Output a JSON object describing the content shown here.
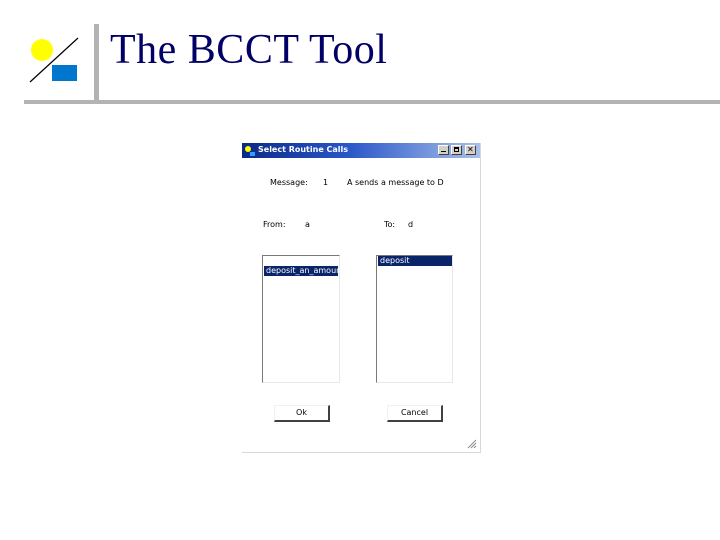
{
  "slide": {
    "title": "The BCCT Tool"
  },
  "dialog": {
    "title": "Select Routine Calls",
    "message_label": "Message:",
    "message_number": "1",
    "message_text": "A sends a message to D",
    "from_label": "From:",
    "from_value": "a",
    "to_label": "To:",
    "to_value": "d",
    "left_list": {
      "items": [
        "deposit_an_amount"
      ],
      "selected": "deposit_an_amount"
    },
    "right_list": {
      "items": [
        "deposit"
      ],
      "selected": "deposit"
    },
    "ok_label": "Ok",
    "cancel_label": "Cancel"
  },
  "colors": {
    "title_text": "#000066",
    "logo_yellow": "#ffff00",
    "logo_blue": "#0077cc",
    "selection": "#0a246a",
    "titlebar": "#0b2a86"
  }
}
